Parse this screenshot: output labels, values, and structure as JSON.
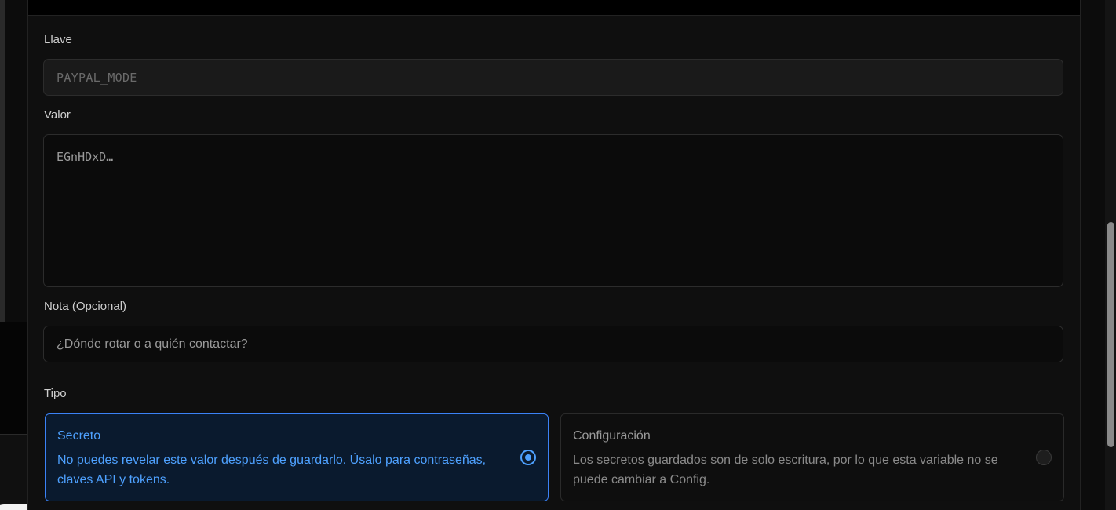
{
  "form": {
    "key_label": "Llave",
    "key_value": "PAYPAL_MODE",
    "value_label": "Valor",
    "value_masked": "EGnHDxD…",
    "note_label": "Nota (Opcional)",
    "note_placeholder": "¿Dónde rotar o a quién contactar?",
    "type_label": "Tipo"
  },
  "type_options": [
    {
      "title": "Secreto",
      "description": "No puedes revelar este valor después de guardarlo. Úsalo para contraseñas, claves API y tokens.",
      "selected": true
    },
    {
      "title": "Configuración",
      "description": "Los secretos guardados son de solo escritura, por lo que esta variable no se puede cambiar a Config.",
      "selected": false
    }
  ],
  "colors": {
    "accent": "#4ea1ff",
    "selected_border": "#3b82f6",
    "background": "#0f0f0f"
  }
}
